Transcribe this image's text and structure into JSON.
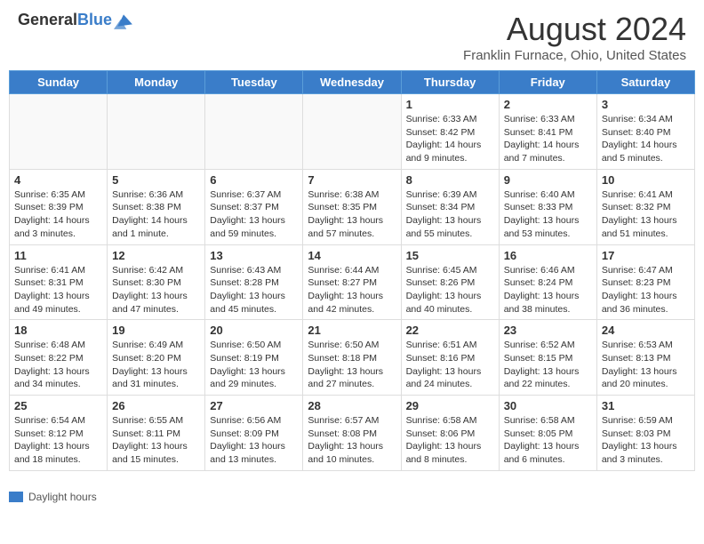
{
  "header": {
    "logo_general": "General",
    "logo_blue": "Blue",
    "month_year": "August 2024",
    "location": "Franklin Furnace, Ohio, United States"
  },
  "legend": {
    "label": "Daylight hours"
  },
  "days_of_week": [
    "Sunday",
    "Monday",
    "Tuesday",
    "Wednesday",
    "Thursday",
    "Friday",
    "Saturday"
  ],
  "weeks": [
    [
      {
        "num": "",
        "info": ""
      },
      {
        "num": "",
        "info": ""
      },
      {
        "num": "",
        "info": ""
      },
      {
        "num": "",
        "info": ""
      },
      {
        "num": "1",
        "info": "Sunrise: 6:33 AM\nSunset: 8:42 PM\nDaylight: 14 hours and 9 minutes."
      },
      {
        "num": "2",
        "info": "Sunrise: 6:33 AM\nSunset: 8:41 PM\nDaylight: 14 hours and 7 minutes."
      },
      {
        "num": "3",
        "info": "Sunrise: 6:34 AM\nSunset: 8:40 PM\nDaylight: 14 hours and 5 minutes."
      }
    ],
    [
      {
        "num": "4",
        "info": "Sunrise: 6:35 AM\nSunset: 8:39 PM\nDaylight: 14 hours and 3 minutes."
      },
      {
        "num": "5",
        "info": "Sunrise: 6:36 AM\nSunset: 8:38 PM\nDaylight: 14 hours and 1 minute."
      },
      {
        "num": "6",
        "info": "Sunrise: 6:37 AM\nSunset: 8:37 PM\nDaylight: 13 hours and 59 minutes."
      },
      {
        "num": "7",
        "info": "Sunrise: 6:38 AM\nSunset: 8:35 PM\nDaylight: 13 hours and 57 minutes."
      },
      {
        "num": "8",
        "info": "Sunrise: 6:39 AM\nSunset: 8:34 PM\nDaylight: 13 hours and 55 minutes."
      },
      {
        "num": "9",
        "info": "Sunrise: 6:40 AM\nSunset: 8:33 PM\nDaylight: 13 hours and 53 minutes."
      },
      {
        "num": "10",
        "info": "Sunrise: 6:41 AM\nSunset: 8:32 PM\nDaylight: 13 hours and 51 minutes."
      }
    ],
    [
      {
        "num": "11",
        "info": "Sunrise: 6:41 AM\nSunset: 8:31 PM\nDaylight: 13 hours and 49 minutes."
      },
      {
        "num": "12",
        "info": "Sunrise: 6:42 AM\nSunset: 8:30 PM\nDaylight: 13 hours and 47 minutes."
      },
      {
        "num": "13",
        "info": "Sunrise: 6:43 AM\nSunset: 8:28 PM\nDaylight: 13 hours and 45 minutes."
      },
      {
        "num": "14",
        "info": "Sunrise: 6:44 AM\nSunset: 8:27 PM\nDaylight: 13 hours and 42 minutes."
      },
      {
        "num": "15",
        "info": "Sunrise: 6:45 AM\nSunset: 8:26 PM\nDaylight: 13 hours and 40 minutes."
      },
      {
        "num": "16",
        "info": "Sunrise: 6:46 AM\nSunset: 8:24 PM\nDaylight: 13 hours and 38 minutes."
      },
      {
        "num": "17",
        "info": "Sunrise: 6:47 AM\nSunset: 8:23 PM\nDaylight: 13 hours and 36 minutes."
      }
    ],
    [
      {
        "num": "18",
        "info": "Sunrise: 6:48 AM\nSunset: 8:22 PM\nDaylight: 13 hours and 34 minutes."
      },
      {
        "num": "19",
        "info": "Sunrise: 6:49 AM\nSunset: 8:20 PM\nDaylight: 13 hours and 31 minutes."
      },
      {
        "num": "20",
        "info": "Sunrise: 6:50 AM\nSunset: 8:19 PM\nDaylight: 13 hours and 29 minutes."
      },
      {
        "num": "21",
        "info": "Sunrise: 6:50 AM\nSunset: 8:18 PM\nDaylight: 13 hours and 27 minutes."
      },
      {
        "num": "22",
        "info": "Sunrise: 6:51 AM\nSunset: 8:16 PM\nDaylight: 13 hours and 24 minutes."
      },
      {
        "num": "23",
        "info": "Sunrise: 6:52 AM\nSunset: 8:15 PM\nDaylight: 13 hours and 22 minutes."
      },
      {
        "num": "24",
        "info": "Sunrise: 6:53 AM\nSunset: 8:13 PM\nDaylight: 13 hours and 20 minutes."
      }
    ],
    [
      {
        "num": "25",
        "info": "Sunrise: 6:54 AM\nSunset: 8:12 PM\nDaylight: 13 hours and 18 minutes."
      },
      {
        "num": "26",
        "info": "Sunrise: 6:55 AM\nSunset: 8:11 PM\nDaylight: 13 hours and 15 minutes."
      },
      {
        "num": "27",
        "info": "Sunrise: 6:56 AM\nSunset: 8:09 PM\nDaylight: 13 hours and 13 minutes."
      },
      {
        "num": "28",
        "info": "Sunrise: 6:57 AM\nSunset: 8:08 PM\nDaylight: 13 hours and 10 minutes."
      },
      {
        "num": "29",
        "info": "Sunrise: 6:58 AM\nSunset: 8:06 PM\nDaylight: 13 hours and 8 minutes."
      },
      {
        "num": "30",
        "info": "Sunrise: 6:58 AM\nSunset: 8:05 PM\nDaylight: 13 hours and 6 minutes."
      },
      {
        "num": "31",
        "info": "Sunrise: 6:59 AM\nSunset: 8:03 PM\nDaylight: 13 hours and 3 minutes."
      }
    ]
  ]
}
